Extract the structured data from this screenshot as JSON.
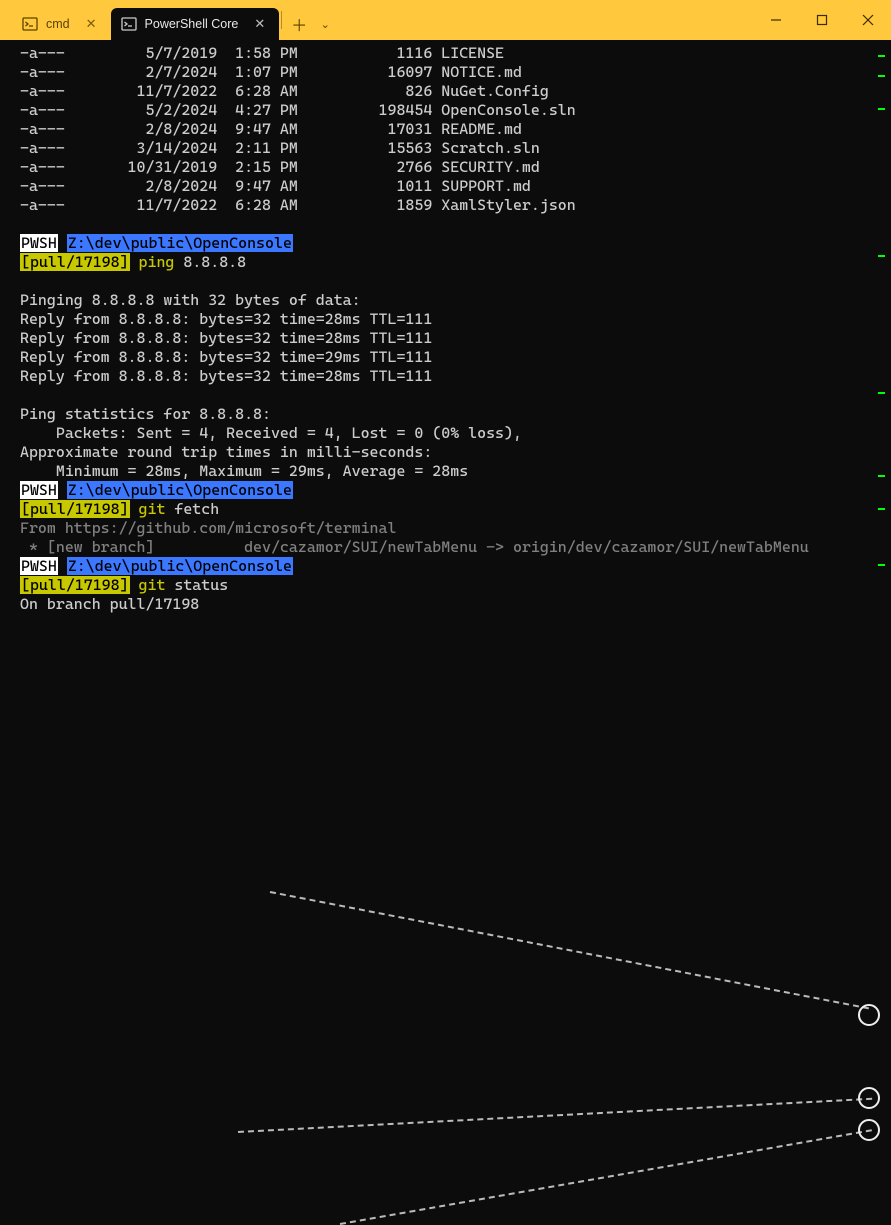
{
  "tabs": [
    {
      "label": "cmd",
      "icon": ">_"
    },
    {
      "label": "PowerShell Core",
      "icon": ">_"
    }
  ],
  "files": [
    {
      "mode": "-a---",
      "date": "5/7/2019",
      "time": "1:58 PM",
      "size": "1116",
      "name": "LICENSE"
    },
    {
      "mode": "-a---",
      "date": "2/7/2024",
      "time": "1:07 PM",
      "size": "16097",
      "name": "NOTICE.md"
    },
    {
      "mode": "-a---",
      "date": "11/7/2022",
      "time": "6:28 AM",
      "size": "826",
      "name": "NuGet.Config"
    },
    {
      "mode": "-a---",
      "date": "5/2/2024",
      "time": "4:27 PM",
      "size": "198454",
      "name": "OpenConsole.sln"
    },
    {
      "mode": "-a---",
      "date": "2/8/2024",
      "time": "9:47 AM",
      "size": "17031",
      "name": "README.md"
    },
    {
      "mode": "-a---",
      "date": "3/14/2024",
      "time": "2:11 PM",
      "size": "15563",
      "name": "Scratch.sln"
    },
    {
      "mode": "-a---",
      "date": "10/31/2019",
      "time": "2:15 PM",
      "size": "2766",
      "name": "SECURITY.md"
    },
    {
      "mode": "-a---",
      "date": "2/8/2024",
      "time": "9:47 AM",
      "size": "1011",
      "name": "SUPPORT.md"
    },
    {
      "mode": "-a---",
      "date": "11/7/2022",
      "time": "6:28 AM",
      "size": "1859",
      "name": "XamlStyler.json"
    }
  ],
  "prompt": {
    "shell": "PWSH",
    "path": "Z:\\dev\\public\\OpenConsole",
    "branch": "[pull/17198]",
    "glyph_path": "",
    "glyph_branch": ""
  },
  "commands": {
    "ping_cmd": "ping",
    "ping_args": " 8.8.8.8",
    "fetch_cmd": "git",
    "fetch_args": " fetch",
    "status_cmd": "git",
    "status_args": " status"
  },
  "output": {
    "ping_header": "Pinging 8.8.8.8 with 32 bytes of data:",
    "ping_replies": [
      "Reply from 8.8.8.8: bytes=32 time=28ms TTL=111",
      "Reply from 8.8.8.8: bytes=32 time=28ms TTL=111",
      "Reply from 8.8.8.8: bytes=32 time=29ms TTL=111",
      "Reply from 8.8.8.8: bytes=32 time=28ms TTL=111"
    ],
    "ping_stats_header": "Ping statistics for 8.8.8.8:",
    "ping_packets": "    Packets: Sent = 4, Received = 4, Lost = 0 (0% loss),",
    "ping_rtt_header": "Approximate round trip times in milli-seconds:",
    "ping_rtt": "    Minimum = 28ms, Maximum = 29ms, Average = 28ms",
    "fetch_from": "From https://github.com/microsoft/terminal",
    "fetch_branch": " * [new branch]          dev/cazamor/SUI/newTabMenu -> origin/dev/cazamor/SUI/newTabMenu",
    "status_branch": "On branch pull/17198"
  }
}
